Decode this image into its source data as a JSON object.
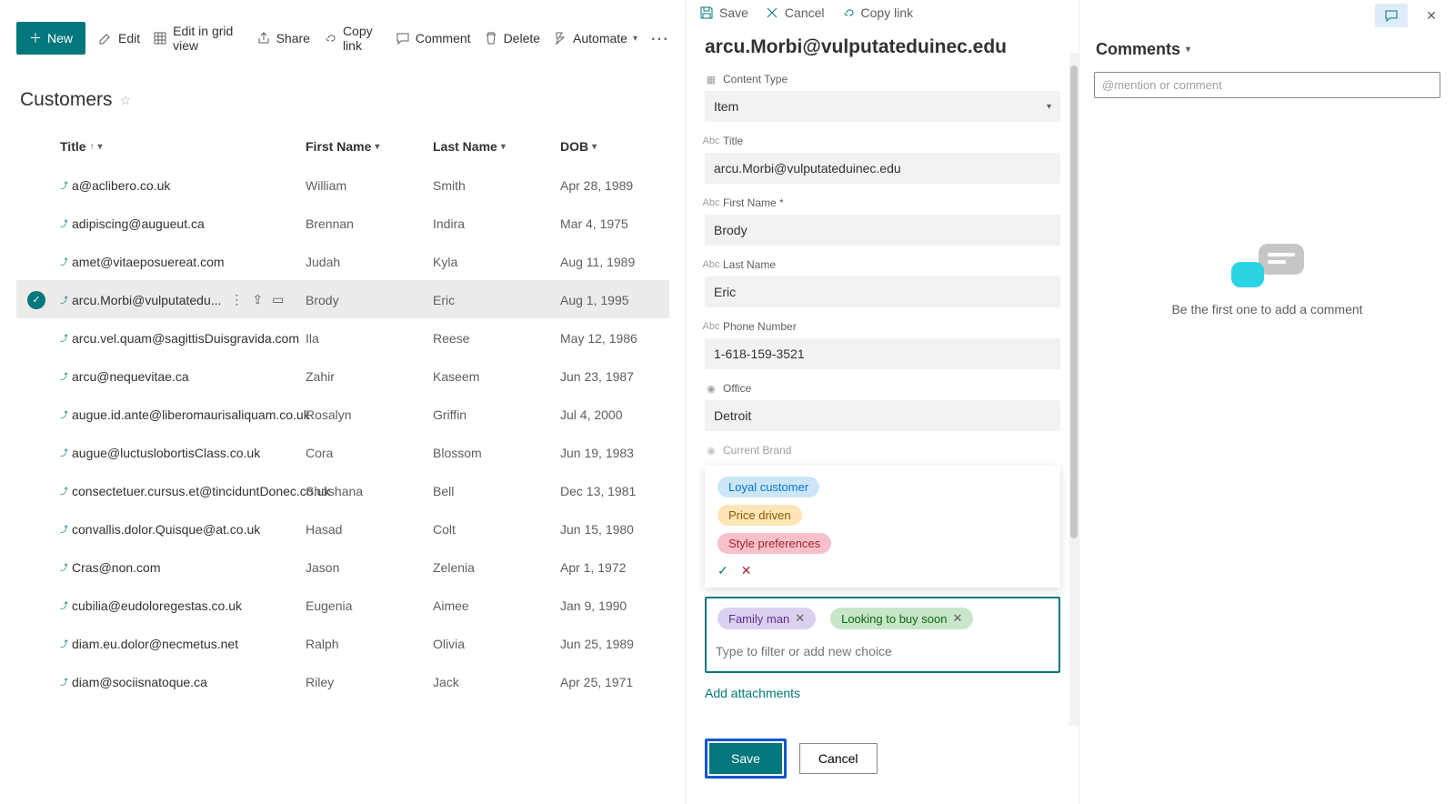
{
  "toolbar": {
    "new": "New",
    "edit": "Edit",
    "edit_grid": "Edit in grid view",
    "share": "Share",
    "copy_link": "Copy link",
    "comment": "Comment",
    "delete": "Delete",
    "automate": "Automate"
  },
  "list": {
    "name": "Customers",
    "headers": {
      "title": "Title",
      "first": "First Name",
      "last": "Last Name",
      "dob": "DOB"
    },
    "selected_index": 3,
    "rows": [
      {
        "title": "a@aclibero.co.uk",
        "first": "William",
        "last": "Smith",
        "dob": "Apr 28, 1989"
      },
      {
        "title": "adipiscing@augueut.ca",
        "first": "Brennan",
        "last": "Indira",
        "dob": "Mar 4, 1975"
      },
      {
        "title": "amet@vitaeposuereat.com",
        "first": "Judah",
        "last": "Kyla",
        "dob": "Aug 11, 1989"
      },
      {
        "title": "arcu.Morbi@vulputatedu...",
        "first": "Brody",
        "last": "Eric",
        "dob": "Aug 1, 1995"
      },
      {
        "title": "arcu.vel.quam@sagittisDuisgravida.com",
        "first": "Ila",
        "last": "Reese",
        "dob": "May 12, 1986"
      },
      {
        "title": "arcu@nequevitae.ca",
        "first": "Zahir",
        "last": "Kaseem",
        "dob": "Jun 23, 1987"
      },
      {
        "title": "augue.id.ante@liberomaurisaliquam.co.uk",
        "first": "Rosalyn",
        "last": "Griffin",
        "dob": "Jul 4, 2000"
      },
      {
        "title": "augue@luctuslobortisClass.co.uk",
        "first": "Cora",
        "last": "Blossom",
        "dob": "Jun 19, 1983"
      },
      {
        "title": "consectetuer.cursus.et@tinciduntDonec.co.uk",
        "first": "Shoshana",
        "last": "Bell",
        "dob": "Dec 13, 1981"
      },
      {
        "title": "convallis.dolor.Quisque@at.co.uk",
        "first": "Hasad",
        "last": "Colt",
        "dob": "Jun 15, 1980"
      },
      {
        "title": "Cras@non.com",
        "first": "Jason",
        "last": "Zelenia",
        "dob": "Apr 1, 1972"
      },
      {
        "title": "cubilia@eudoloregestas.co.uk",
        "first": "Eugenia",
        "last": "Aimee",
        "dob": "Jan 9, 1990"
      },
      {
        "title": "diam.eu.dolor@necmetus.net",
        "first": "Ralph",
        "last": "Olivia",
        "dob": "Jun 25, 1989"
      },
      {
        "title": "diam@sociisnatoque.ca",
        "first": "Riley",
        "last": "Jack",
        "dob": "Apr 25, 1971"
      }
    ]
  },
  "panel": {
    "tb": {
      "save": "Save",
      "cancel": "Cancel",
      "copy_link": "Copy link"
    },
    "title": "arcu.Morbi@vulputateduinec.edu",
    "fields": {
      "content_type_label": "Content Type",
      "content_type": "Item",
      "title_label": "Title",
      "title": "arcu.Morbi@vulputateduinec.edu",
      "first_label": "First Name *",
      "first": "Brody",
      "last_label": "Last Name",
      "last": "Eric",
      "phone_label": "Phone Number",
      "phone": "1-618-159-3521",
      "office_label": "Office",
      "office": "Detroit",
      "brand_label": "Current Brand"
    },
    "choice_options": [
      {
        "label": "Loyal customer",
        "bg": "#cde6f7",
        "fg": "#0078d4"
      },
      {
        "label": "Price driven",
        "bg": "#ffe5b6",
        "fg": "#8a5a00"
      },
      {
        "label": "Style preferences",
        "bg": "#f7c0cb",
        "fg": "#a4262c"
      }
    ],
    "selected_choices": [
      {
        "label": "Family man",
        "bg": "#dcd0f0",
        "fg": "#5c2e91"
      },
      {
        "label": "Looking to buy soon",
        "bg": "#c8e6c9",
        "fg": "#0b6a0b"
      }
    ],
    "choice_placeholder": "Type to filter or add new choice",
    "attach": "Add attachments",
    "footer_save": "Save",
    "footer_cancel": "Cancel"
  },
  "comments": {
    "title": "Comments",
    "placeholder": "@mention or comment",
    "empty": "Be the first one to add a comment"
  }
}
